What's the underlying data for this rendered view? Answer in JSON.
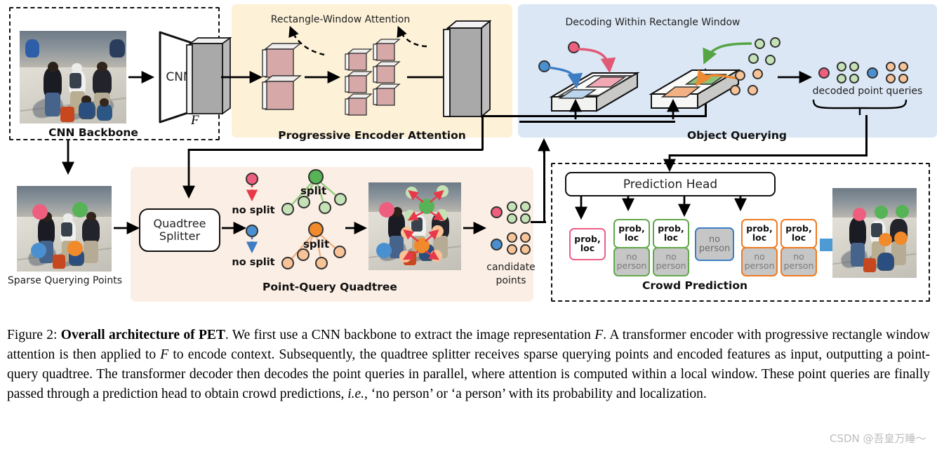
{
  "figure": {
    "panels": {
      "cnn_backbone": {
        "title": "CNN Backbone",
        "cnn_block_label": "CNN",
        "feature_symbol": "F"
      },
      "progressive_encoder": {
        "title": "Progressive Encoder Attention",
        "top_label": "Rectangle-Window Attention"
      },
      "object_querying": {
        "title": "Object Querying",
        "top_label": "Decoding Within Rectangle Window",
        "decoded_label": "decoded point queries"
      },
      "point_query_quadtree": {
        "title": "Point-Query Quadtree",
        "splitter_line1": "Quadtree",
        "splitter_line2": "Splitter",
        "no_split_red": "no split",
        "no_split_blue": "no split",
        "split_green": "split",
        "split_orange": "split",
        "candidate_line1": "candidate",
        "candidate_line2": "points"
      },
      "crowd_prediction": {
        "title": "Crowd Prediction",
        "head_label": "Prediction Head",
        "boxes": [
          {
            "id": "red",
            "top_text": "prob,\nloc",
            "top_color": "#ec5e85",
            "has_bottom": false
          },
          {
            "id": "green1",
            "top_text": "prob,\nloc",
            "top_color": "#63a84c",
            "has_bottom": true,
            "bottom_text": "no\nperson"
          },
          {
            "id": "green2",
            "top_text": "prob,\nloc",
            "top_color": "#63a84c",
            "has_bottom": true,
            "bottom_text": "no\nperson"
          },
          {
            "id": "blue",
            "top_text": "no\nperson",
            "top_color": "#3d7dc4",
            "has_bottom": false
          },
          {
            "id": "orange1",
            "top_text": "prob,\nloc",
            "top_color": "#f07b22",
            "has_bottom": true,
            "bottom_text": "no\nperson"
          },
          {
            "id": "orange2",
            "top_text": "prob,\nloc",
            "top_color": "#f07b22",
            "has_bottom": true,
            "bottom_text": "no\nperson"
          }
        ]
      },
      "sparse_querying_points": {
        "label": "Sparse Querying Points"
      }
    },
    "colors": {
      "panel_yellow": "#fdf1d8",
      "panel_blue": "#dbe7f5",
      "panel_peach": "#fbeee4",
      "point_red": "#ee5f7f",
      "point_blue": "#4a90d0",
      "point_green": "#56b356",
      "point_orange": "#f08a2b",
      "point_green_light": "#c4e2b6",
      "point_orange_light": "#f8c396",
      "window_red": "#f2a8b4",
      "window_blue": "#bcd5ec",
      "window_green": "#8cc37a",
      "window_orange": "#f1b183",
      "encoder_tile": "#d6a8a8",
      "feature_gray": "#a8a8a8",
      "arrow_blue": "#4e9ad4",
      "split_arrow_red": "#e8394a"
    },
    "prediction_box_labels": {
      "prob_loc": "prob, loc",
      "no_person": "no person"
    }
  },
  "caption": {
    "prefix": "Figure 2: ",
    "bold_title": "Overall architecture of PET",
    "body_1": ". We first use a CNN backbone to extract the image representation ",
    "sym_1": "F",
    "body_2": ". A transformer encoder with progressive rectangle window attention is then applied to ",
    "sym_2": "F",
    "body_3": " to encode context. Subsequently, the quadtree splitter receives sparse querying points and encoded features as input, outputting a point-query quadtree. The transformer decoder then decodes the point queries in parallel, where attention is computed within a local window. These point queries are finally passed through a prediction head to obtain crowd predictions, ",
    "italic_ie": "i.e.",
    "body_4": ", ‘no person’ or ‘a person’ with its probability and localization."
  },
  "watermark": {
    "text": "CSDN @吾皇万睡～"
  }
}
